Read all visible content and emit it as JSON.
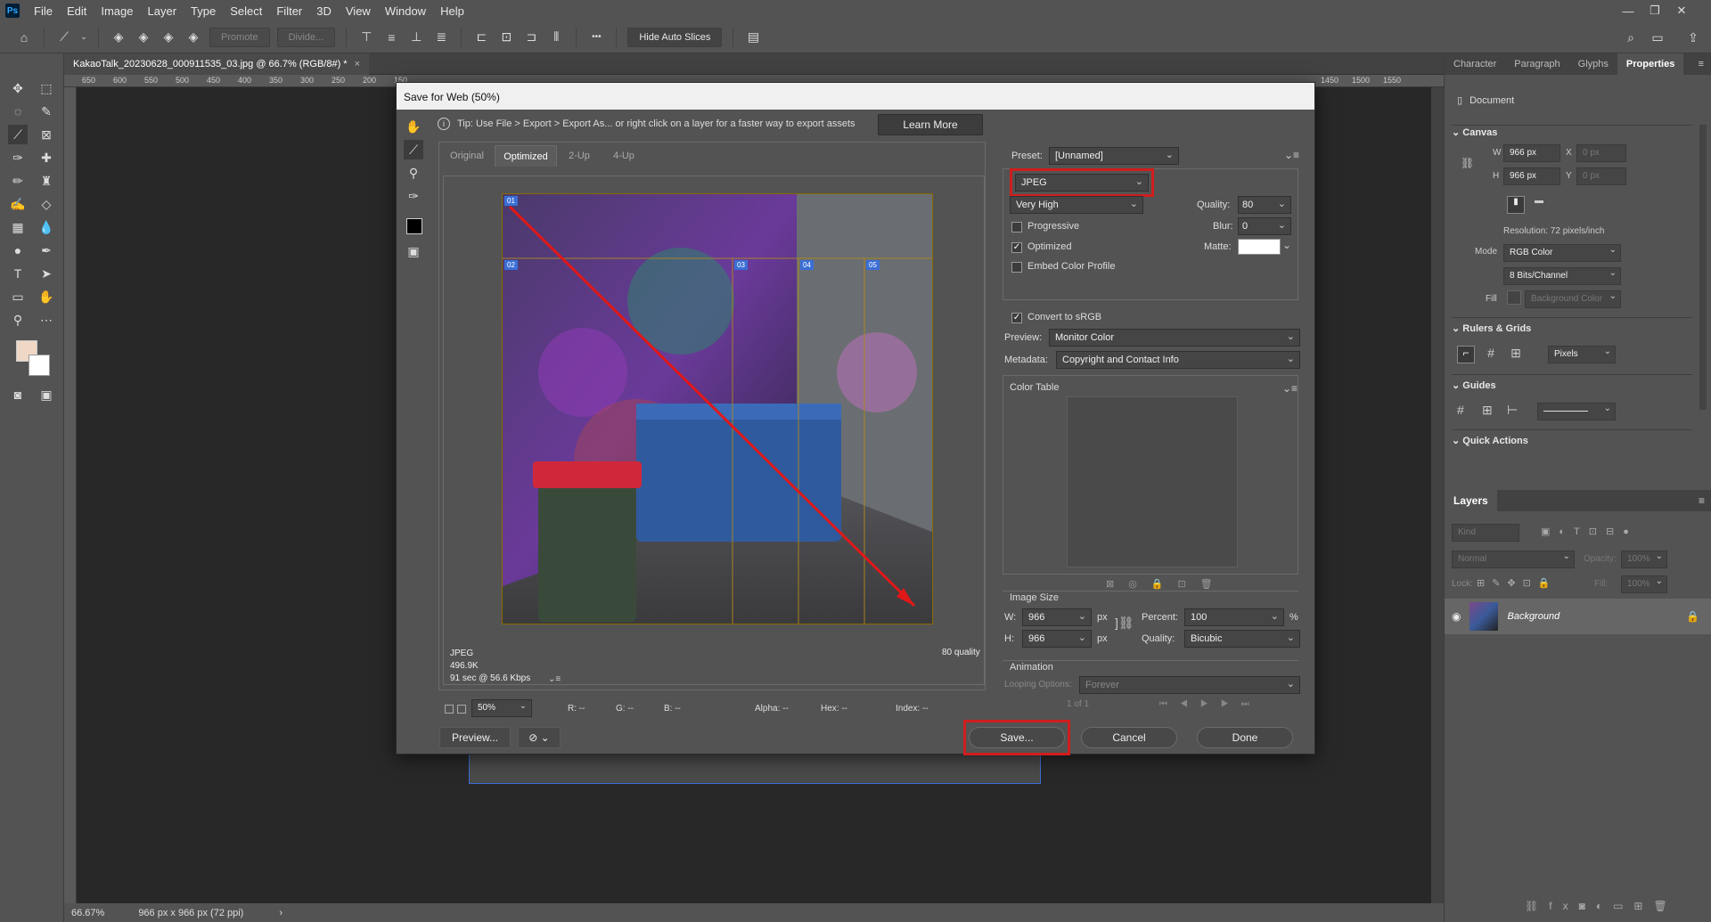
{
  "menubar": {
    "logo": "Ps",
    "items": [
      "File",
      "Edit",
      "Image",
      "Layer",
      "Type",
      "Select",
      "Filter",
      "3D",
      "View",
      "Window",
      "Help"
    ],
    "window_controls": [
      "—",
      "❐",
      "✕"
    ]
  },
  "optbar": {
    "promote": "Promote",
    "divide": "Divide...",
    "more": "•••",
    "hide_auto_slices": "Hide Auto Slices"
  },
  "document": {
    "tab_title": "KakaoTalk_20230628_000911535_03.jpg @ 66.7% (RGB/8#) *",
    "close": "×",
    "ruler_marks": [
      "650",
      "600",
      "550",
      "500",
      "450",
      "400",
      "350",
      "300",
      "250",
      "200",
      "150"
    ],
    "ruler_marks_right": [
      "1450",
      "1500",
      "1550"
    ],
    "status_zoom": "66.67%",
    "status_info": "966 px x 966 px (72 ppi)",
    "status_arrow": "›"
  },
  "right_panel": {
    "tabs": [
      "Character",
      "Paragraph",
      "Glyphs",
      "Properties"
    ],
    "active_tab": "Properties",
    "doc_label": "Document",
    "canvas_title": "Canvas",
    "w_label": "W",
    "w_value": "966 px",
    "h_label": "H",
    "h_value": "966 px",
    "x_label": "X",
    "x_value": "0 px",
    "y_label": "Y",
    "y_value": "0 px",
    "resolution": "Resolution: 72 pixels/inch",
    "mode_label": "Mode",
    "mode_value": "RGB Color",
    "bits_value": "8 Bits/Channel",
    "fill_label": "Fill",
    "fill_value": "Background Color",
    "rulers_title": "Rulers & Grids",
    "units_value": "Pixels",
    "guides_title": "Guides",
    "quick_actions_title": "Quick Actions",
    "layers_title": "Layers",
    "kind_placeholder": "Kind",
    "blend_mode": "Normal",
    "opacity_label": "Opacity:",
    "opacity_value": "100%",
    "lock_label": "Lock:",
    "fill_label2": "Fill:",
    "fill_value2": "100%",
    "layer_name": "Background"
  },
  "dialog": {
    "title": "Save for Web (50%)",
    "tip": "Tip: Use File > Export > Export As...  or right click on a layer for a faster way to export assets",
    "learn_more": "Learn More",
    "view_tabs": [
      "Original",
      "Optimized",
      "2-Up",
      "4-Up"
    ],
    "active_view": "Optimized",
    "slices": [
      "01",
      "02",
      "03",
      "04",
      "05"
    ],
    "file_format": "JPEG",
    "file_size": "496.9K",
    "download_time": "91 sec @ 56.6 Kbps",
    "quality_note": "80 quality",
    "zoom": "50%",
    "r": "R: --",
    "g": "G: --",
    "b": "B: --",
    "alpha": "Alpha: --",
    "hex": "Hex: --",
    "index": "Index: --",
    "preview_btn": "Preview...",
    "save_btn": "Save...",
    "cancel_btn": "Cancel",
    "done_btn": "Done",
    "settings": {
      "preset_label": "Preset:",
      "preset_value": "[Unnamed]",
      "format_value": "JPEG",
      "quality_preset": "Very High",
      "quality_label": "Quality:",
      "quality_value": "80",
      "progressive_label": "Progressive",
      "blur_label": "Blur:",
      "blur_value": "0",
      "optimized_label": "Optimized",
      "matte_label": "Matte:",
      "embed_label": "Embed Color Profile",
      "convert_label": "Convert to sRGB",
      "preview_label": "Preview:",
      "preview_value": "Monitor Color",
      "metadata_label": "Metadata:",
      "metadata_value": "Copyright and Contact Info",
      "color_table_label": "Color Table",
      "image_size_label": "Image Size",
      "w_label": "W:",
      "w_value": "966",
      "h_label": "H:",
      "h_value": "966",
      "px": "px",
      "percent_label": "Percent:",
      "percent_value": "100",
      "percent_sign": "%",
      "resample_label": "Quality:",
      "resample_value": "Bicubic",
      "animation_label": "Animation",
      "looping_label": "Looping Options:",
      "looping_value": "Forever",
      "frame_counter": "1 of 1"
    }
  }
}
